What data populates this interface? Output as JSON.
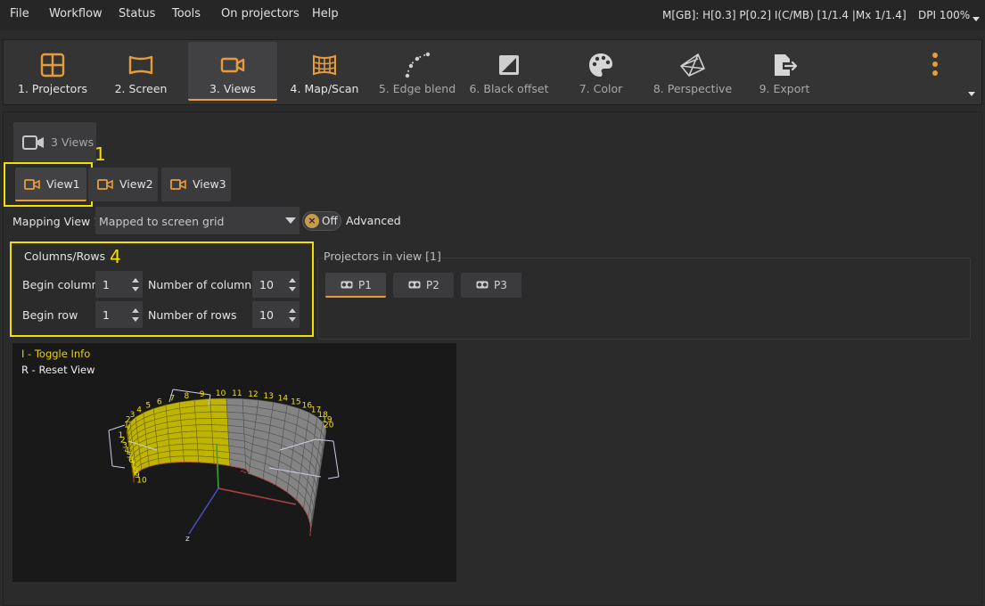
{
  "menu": {
    "items": [
      "File",
      "Workflow",
      "Status",
      "Tools",
      "On projectors",
      "Help"
    ],
    "status_readout": "M[GB]: H[0.3] P[0.2] I(C/MB) [1/1.4 |Mx 1/1.4]",
    "dpi": "DPI 100%"
  },
  "toolbar": {
    "tools": [
      {
        "label": "1. Projectors",
        "icon": "projectors-grid-icon"
      },
      {
        "label": "2. Screen",
        "icon": "screen-icon"
      },
      {
        "label": "3. Views",
        "icon": "camera-icon",
        "active": true
      },
      {
        "label": "4. Map/Scan",
        "icon": "map-scan-icon"
      },
      {
        "label": "5. Edge blend",
        "icon": "edge-blend-icon"
      },
      {
        "label": "6. Black offset",
        "icon": "black-offset-icon"
      },
      {
        "label": "7. Color",
        "icon": "palette-icon"
      },
      {
        "label": "8. Perspective",
        "icon": "perspective-icon"
      },
      {
        "label": "9. Export",
        "icon": "export-icon"
      }
    ]
  },
  "views": {
    "count_label": "3 Views",
    "tabs": [
      "View1",
      "View2",
      "View3"
    ],
    "selected": "View1"
  },
  "annotations": {
    "one": "1",
    "four": "4"
  },
  "mapping": {
    "label": "Mapping View 1",
    "value": "Mapped to screen grid",
    "toggle_label": "Off",
    "advanced_label": "Advanced"
  },
  "colrows": {
    "title": "Columns/Rows",
    "begin_column_label": "Begin column",
    "begin_column": "1",
    "num_columns_label": "Number of columns",
    "num_columns": "10",
    "begin_row_label": "Begin row",
    "begin_row": "1",
    "num_rows_label": "Number of rows",
    "num_rows": "10"
  },
  "projectors_in_view": {
    "title": "Projectors in view [1]",
    "buttons": [
      "P1",
      "P2",
      "P3"
    ],
    "selected": "P1"
  },
  "viewport": {
    "hint_toggle": "I - Toggle Info",
    "hint_reset": "R - Reset View",
    "column_numbers": [
      "1",
      "2",
      "3",
      "4",
      "5",
      "6",
      "7",
      "8",
      "9",
      "10",
      "11",
      "12",
      "13",
      "14",
      "15",
      "16",
      "17",
      "18",
      "19",
      "20"
    ],
    "row_numbers": [
      "1",
      "2",
      "3",
      "4",
      "5",
      "6",
      "7",
      "8",
      "9",
      "10"
    ],
    "axis_label": "z"
  },
  "colors": {
    "accent": "#e79c3c",
    "annotation": "#f2e100",
    "mesh_yellow": "#c8bd00",
    "mesh_gray": "#8a8a8a"
  }
}
